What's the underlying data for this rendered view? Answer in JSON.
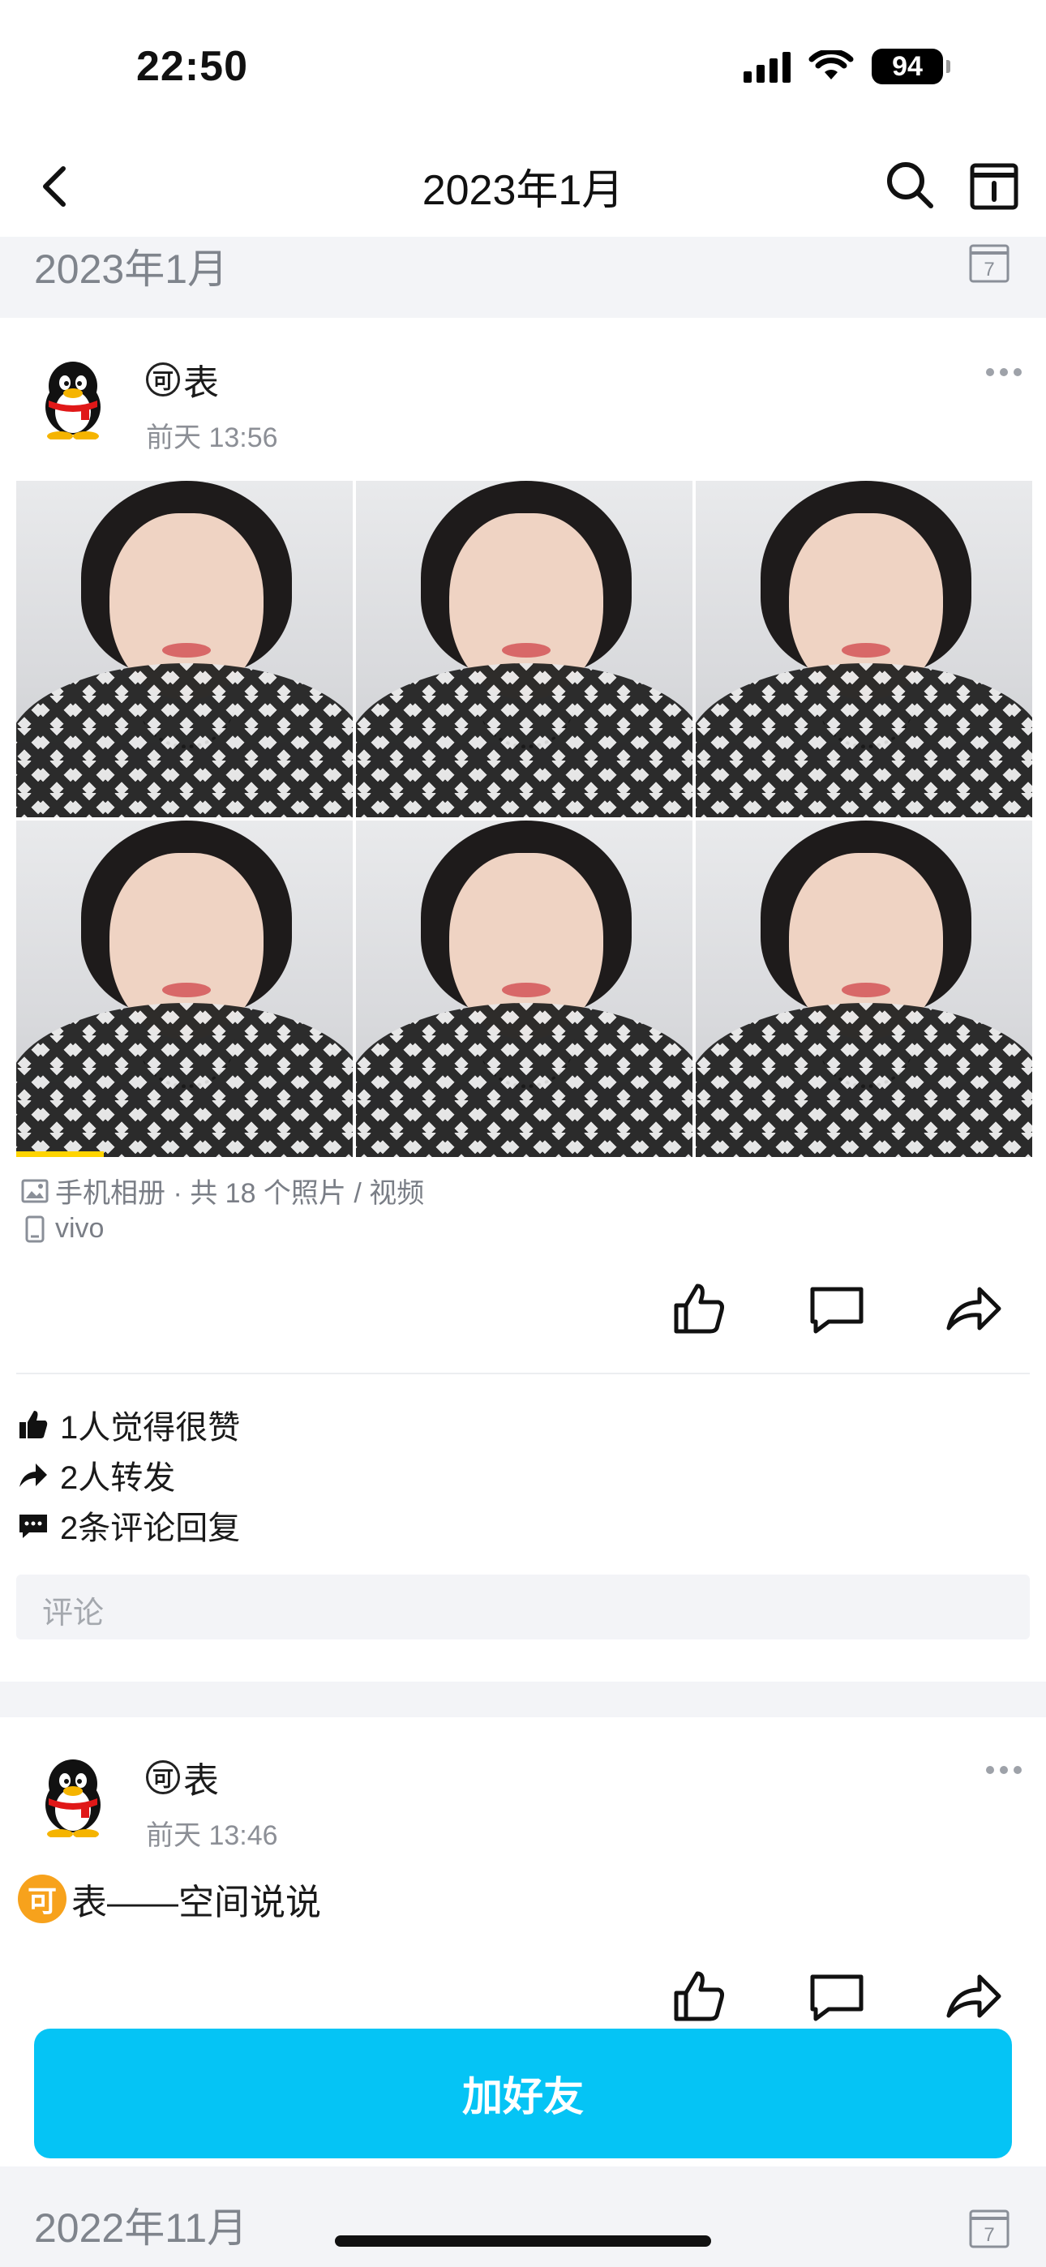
{
  "status_bar": {
    "time": "22:50",
    "battery": "94"
  },
  "nav": {
    "title": "2023年1月"
  },
  "sections": [
    {
      "title": "2023年1月",
      "calendar_day": "7"
    },
    {
      "title": "2022年11月",
      "calendar_day": "7"
    }
  ],
  "posts": [
    {
      "author": "表",
      "author_badge": "可",
      "time": "前天 13:56",
      "album_text": "手机相册 · 共 18 个照片 / 视频",
      "device": "vivo",
      "photo_count_visible": 6,
      "video_progress": 0.26,
      "stats": {
        "likes": "1人觉得很赞",
        "shares": "2人转发",
        "comments": "2条评论回复"
      },
      "comment_placeholder": "评论"
    },
    {
      "author": "表",
      "author_badge": "可",
      "time": "前天 13:46",
      "text_badge": "可",
      "text": "表——空间说说"
    }
  ],
  "add_friend": {
    "label": "加好友"
  },
  "colors": {
    "accent": "#05c4f5",
    "badge": "#f7a21c",
    "progress": "#ffd400"
  },
  "icons": [
    "back-icon",
    "search-icon",
    "calendar-icon",
    "more-icon",
    "like-icon",
    "comment-icon",
    "share-icon",
    "image-icon",
    "phone-icon"
  ]
}
